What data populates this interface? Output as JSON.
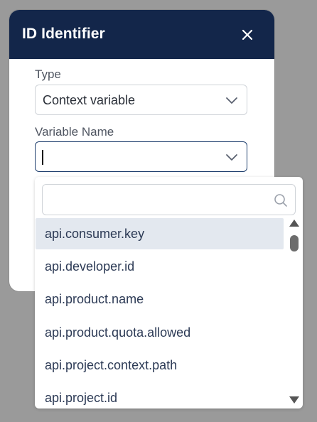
{
  "dialog": {
    "title": "ID Identifier",
    "close_icon": "close-icon"
  },
  "type_field": {
    "label": "Type",
    "value": "Context variable",
    "icon": "chevron-down-icon"
  },
  "variable_field": {
    "label": "Variable Name",
    "value": "",
    "icon": "chevron-down-icon"
  },
  "dropdown": {
    "search": {
      "value": "",
      "placeholder": "",
      "icon": "search-icon"
    },
    "options": [
      {
        "label": "api.consumer.key",
        "highlighted": true
      },
      {
        "label": "api.developer.id",
        "highlighted": false
      },
      {
        "label": "api.product.name",
        "highlighted": false
      },
      {
        "label": "api.product.quota.allowed",
        "highlighted": false
      },
      {
        "label": "api.project.context.path",
        "highlighted": false
      },
      {
        "label": "api.project.id",
        "highlighted": false
      }
    ]
  },
  "colors": {
    "header_bg": "#13264a",
    "backdrop": "#9a9a9a",
    "highlight": "#e3e8ef",
    "focus_border": "#1f3f6e"
  }
}
